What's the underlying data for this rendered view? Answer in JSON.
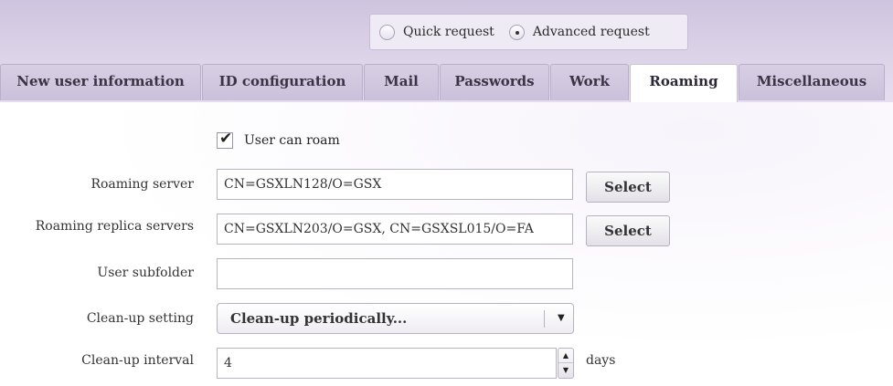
{
  "request_mode": {
    "options": [
      {
        "label": "Quick request",
        "selected": false
      },
      {
        "label": "Advanced request",
        "selected": true
      }
    ]
  },
  "tabs": [
    {
      "label": "New user information",
      "active": false
    },
    {
      "label": "ID configuration",
      "active": false
    },
    {
      "label": "Mail",
      "active": false
    },
    {
      "label": "Passwords",
      "active": false
    },
    {
      "label": "Work",
      "active": false
    },
    {
      "label": "Roaming",
      "active": true
    },
    {
      "label": "Miscellaneous",
      "active": false
    }
  ],
  "roaming": {
    "user_can_roam": {
      "label": "User can roam",
      "checked": true
    },
    "roaming_server": {
      "label": "Roaming server",
      "value": "CN=GSXLN128/O=GSX",
      "button": "Select"
    },
    "replica_servers": {
      "label": "Roaming replica servers",
      "value": "CN=GSXLN203/O=GSX, CN=GSXSL015/O=FA",
      "button": "Select"
    },
    "user_subfolder": {
      "label": "User subfolder",
      "value": ""
    },
    "cleanup_setting": {
      "label": "Clean-up setting",
      "value": "Clean-up periodically..."
    },
    "cleanup_interval": {
      "label": "Clean-up interval",
      "value": "4",
      "unit": "days"
    }
  },
  "colors": {
    "header_bg": "#d8cfe4",
    "tab_bg": "#cbc0da",
    "active_tab_bg": "#ffffff",
    "border": "#b8b2c2"
  }
}
